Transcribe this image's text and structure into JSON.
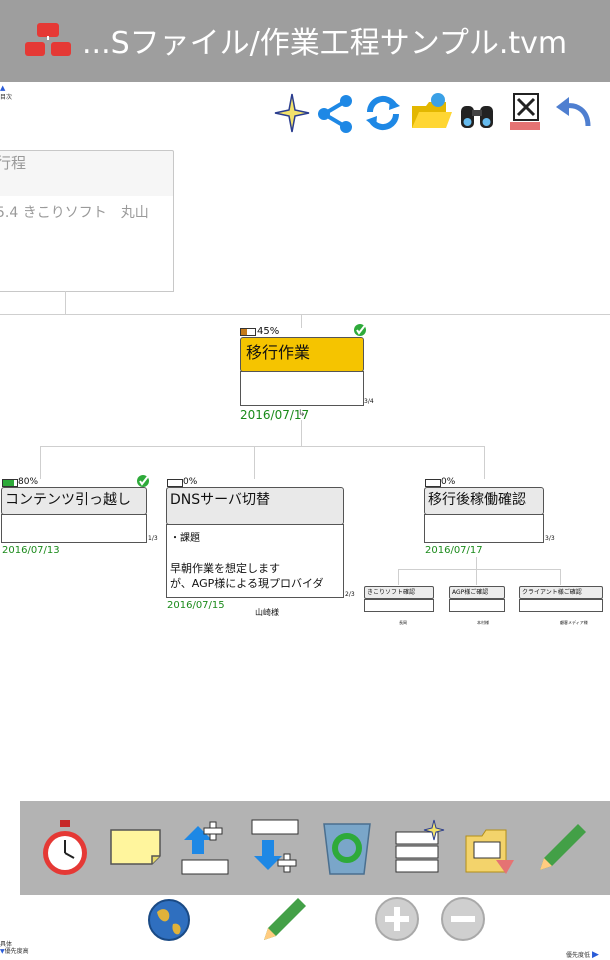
{
  "header": {
    "title": "...Sファイル/作業工程サンプル.tvm"
  },
  "corner_labels": {
    "top_left": "目次",
    "bottom_left_1": "具体",
    "bottom_left_2": "優先度高",
    "bottom_right": "優先度低"
  },
  "toolbar": {
    "icons": [
      "sparkle-icon",
      "share-icon",
      "sync-icon",
      "open-folder-icon",
      "binoculars-icon",
      "close-file-icon",
      "undo-icon"
    ]
  },
  "root": {
    "title": "行程",
    "subtitle": "5.4 きこりソフト　丸山"
  },
  "main_node": {
    "percent_label": "45%",
    "percent": 0.45,
    "title": "移行作業",
    "date": "2016/07/17",
    "count": "3/4",
    "head_color": "#f5c400"
  },
  "children": [
    {
      "percent_label": "80%",
      "percent": 0.8,
      "title": "コンテンツ引っ越し",
      "date": "2016/07/13",
      "count": "1/3",
      "body": "",
      "owner": ""
    },
    {
      "percent_label": "0%",
      "percent": 0.0,
      "title": "DNSサーバ切替",
      "date": "2016/07/15",
      "count": "2/3",
      "body_line1": "・課題",
      "body_line2": "早朝作業を想定します",
      "body_line3": "が、AGP様による現プロバイダ",
      "owner": "山崎様"
    },
    {
      "percent_label": "0%",
      "percent": 0.0,
      "title": "移行後稼働確認",
      "date": "2016/07/17",
      "count": "3/3",
      "body": "",
      "owner": ""
    }
  ],
  "grandchildren": [
    {
      "title": "きこりソフト確認",
      "owner": "長岡"
    },
    {
      "title": "AGP様ご確認",
      "owner": "本村様"
    },
    {
      "title": "クライアント様ご確認",
      "owner": "顧客メディア様"
    }
  ],
  "bottom_toolbar": {
    "icons": [
      "stopwatch-task-icon",
      "sticky-note-icon",
      "add-parent-node-icon",
      "add-child-node-icon",
      "recycle-bin-icon",
      "add-sibling-node-icon",
      "import-file-icon",
      "edit-pencil-icon"
    ]
  },
  "bottom_nav": {
    "icons": [
      "globe-icon",
      "pencil-icon",
      "zoom-in-icon",
      "zoom-out-icon"
    ]
  },
  "colors": {
    "titlebar": "#9e9e9e",
    "accent_red": "#e53935",
    "progress_green": "#2eaa3a",
    "date_green": "#1a8a1a",
    "bottom_bar": "#b3b3b3"
  }
}
